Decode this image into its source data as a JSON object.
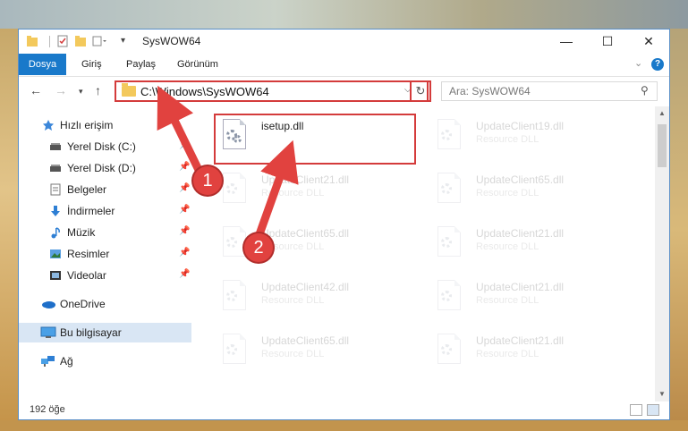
{
  "window": {
    "title": "SysWOW64",
    "minimize_glyph": "—",
    "maximize_glyph": "☐",
    "close_glyph": "✕"
  },
  "ribbon": {
    "tabs": [
      "Dosya",
      "Giriş",
      "Paylaş",
      "Görünüm"
    ],
    "help_glyph": "?"
  },
  "nav": {
    "address": "C:\\Windows\\SysWOW64",
    "search_placeholder": "Ara: SysWOW64"
  },
  "sidebar": {
    "items": [
      {
        "label": "Hızlı erişim",
        "icon": "star-icon"
      },
      {
        "label": "Yerel Disk (C:)",
        "icon": "drive-icon"
      },
      {
        "label": "Yerel Disk (D:)",
        "icon": "drive-icon"
      },
      {
        "label": "Belgeler",
        "icon": "documents-icon"
      },
      {
        "label": "İndirmeler",
        "icon": "download-icon"
      },
      {
        "label": "Müzik",
        "icon": "music-icon"
      },
      {
        "label": "Resimler",
        "icon": "pictures-icon"
      },
      {
        "label": "Videolar",
        "icon": "video-icon"
      },
      {
        "label": "OneDrive",
        "icon": "cloud-icon"
      },
      {
        "label": "Bu bilgisayar",
        "icon": "computer-icon"
      },
      {
        "label": "Ağ",
        "icon": "network-icon"
      }
    ]
  },
  "files": [
    {
      "name": "isetup.dll",
      "type": ""
    },
    {
      "name": "UpdateClient19.dll",
      "type": "Resource DLL"
    },
    {
      "name": "UpdateClient21.dll",
      "type": "Resource DLL"
    },
    {
      "name": "UpdateClient65.dll",
      "type": "Resource DLL"
    },
    {
      "name": "UpdateClient65.dll",
      "type": "Resource DLL"
    },
    {
      "name": "UpdateClient21.dll",
      "type": "Resource DLL"
    },
    {
      "name": "UpdateClient42.dll",
      "type": "Resource DLL"
    },
    {
      "name": "UpdateClient21.dll",
      "type": "Resource DLL"
    },
    {
      "name": "UpdateClient65.dll",
      "type": "Resource DLL"
    },
    {
      "name": "UpdateClient21.dll",
      "type": "Resource DLL"
    }
  ],
  "status": {
    "count": "192 öğe"
  },
  "annotations": {
    "step1": "1",
    "step2": "2",
    "color": "#e1423f"
  },
  "colors": {
    "accent": "#1979ca",
    "highlight": "#d43b3b"
  }
}
